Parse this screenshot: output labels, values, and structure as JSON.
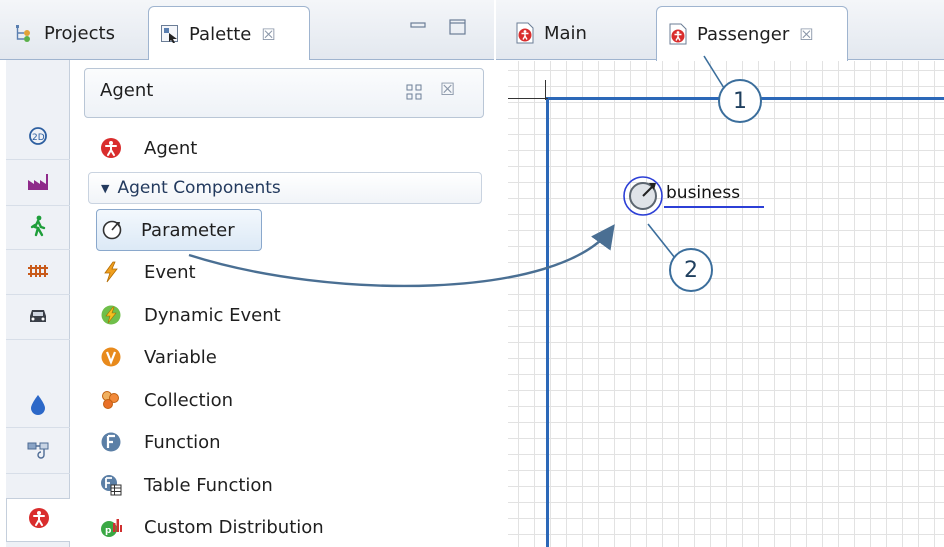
{
  "left_view": {
    "tabs": [
      {
        "label": "Projects",
        "icon": "projects-icon",
        "active": false
      },
      {
        "label": "Palette",
        "icon": "palette-icon",
        "active": true,
        "close": "☒"
      }
    ],
    "minimize_icon": "minimize-icon",
    "maximize_icon": "maximize-icon"
  },
  "palette": {
    "header_title": "Agent",
    "header_close": "☒",
    "categories": [
      "2d-3d-icon",
      "process-modeling-icon",
      "pedestrian-icon",
      "rail-icon",
      "road-traffic-icon",
      "fluid-icon",
      "system-dynamics-icon",
      "agent-icon"
    ],
    "top_item": {
      "label": "Agent",
      "icon": "agent-icon"
    },
    "section": {
      "label": "Agent Components",
      "expanded": true
    },
    "items": [
      {
        "label": "Parameter",
        "icon": "parameter-icon",
        "selected": true
      },
      {
        "label": "Event",
        "icon": "event-icon"
      },
      {
        "label": "Dynamic Event",
        "icon": "dynamic-event-icon"
      },
      {
        "label": "Variable",
        "icon": "variable-icon"
      },
      {
        "label": "Collection",
        "icon": "collection-icon"
      },
      {
        "label": "Function",
        "icon": "function-icon"
      },
      {
        "label": "Table Function",
        "icon": "table-function-icon"
      },
      {
        "label": "Custom Distribution",
        "icon": "custom-distribution-icon"
      }
    ]
  },
  "editor": {
    "tabs": [
      {
        "label": "Main",
        "icon": "agent-type-icon",
        "active": false
      },
      {
        "label": "Passenger",
        "icon": "agent-type-icon",
        "active": true,
        "close": "☒"
      }
    ],
    "canvas": {
      "element": {
        "type": "parameter",
        "name": "business"
      }
    }
  },
  "callouts": [
    "1",
    "2"
  ],
  "colors": {
    "accent": "#2c68b8",
    "callout_border": "#3b6e9c",
    "selection": "#2c3fd6"
  }
}
